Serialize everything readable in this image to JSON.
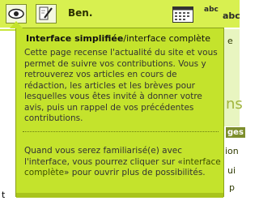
{
  "toolbar": {
    "user_name": "Ben.",
    "icons": [
      "eye-icon",
      "pen-icon",
      "calendar-icon",
      "abc-spellcheck-icon"
    ],
    "abc_small": "abc",
    "abc_big": "abc"
  },
  "bubble": {
    "title_bold": "Interface simplifiée",
    "title_rest": "/interface complète",
    "paragraph1": "Cette page recense l'actualité du site et vous permet de suivre vos contributions. Vous y retrouverez vos articles en cours de rédaction, les articles et les brèves pour lesquelles vous êtes invité à donner votre avis, puis un rappel de vos précédentes contributions.",
    "paragraph2_before": "Quand vous serez familiarisé(e) avec l'interface, vous pourrez cliquer sur «",
    "paragraph2_link": "interface complète",
    "paragraph2_after": "» pour ouvrir plus de possibilités."
  },
  "background": {
    "right_fragments": [
      "e",
      "ns",
      "ges",
      "ion",
      "ui",
      "p"
    ],
    "left_fragment": "t"
  },
  "colors": {
    "accent": "#d8f050",
    "bubble": "#c4e32c"
  }
}
